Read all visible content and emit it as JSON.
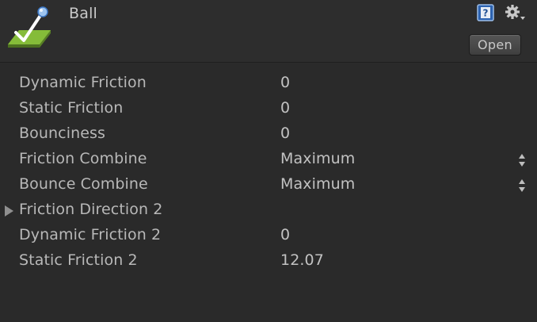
{
  "header": {
    "title": "Ball",
    "asset_icon": "physic-material-icon",
    "help_icon": "help-icon",
    "gear_icon": "gear-icon",
    "open_label": "Open"
  },
  "properties": [
    {
      "label": "Dynamic Friction",
      "value": "0"
    },
    {
      "label": "Static Friction",
      "value": "0"
    },
    {
      "label": "Bounciness",
      "value": "0"
    },
    {
      "label": "Friction Combine",
      "value": "Maximum"
    },
    {
      "label": "Bounce Combine",
      "value": "Maximum"
    },
    {
      "label": "Friction Direction 2",
      "value": ""
    },
    {
      "label": "Dynamic Friction 2",
      "value": "0"
    },
    {
      "label": "Static Friction 2",
      "value": "12.07"
    }
  ],
  "colors": {
    "background": "#2a2a2a",
    "text": "#b8b8b8",
    "icon_green": "#8ac23c",
    "icon_blue": "#3d78c6"
  }
}
